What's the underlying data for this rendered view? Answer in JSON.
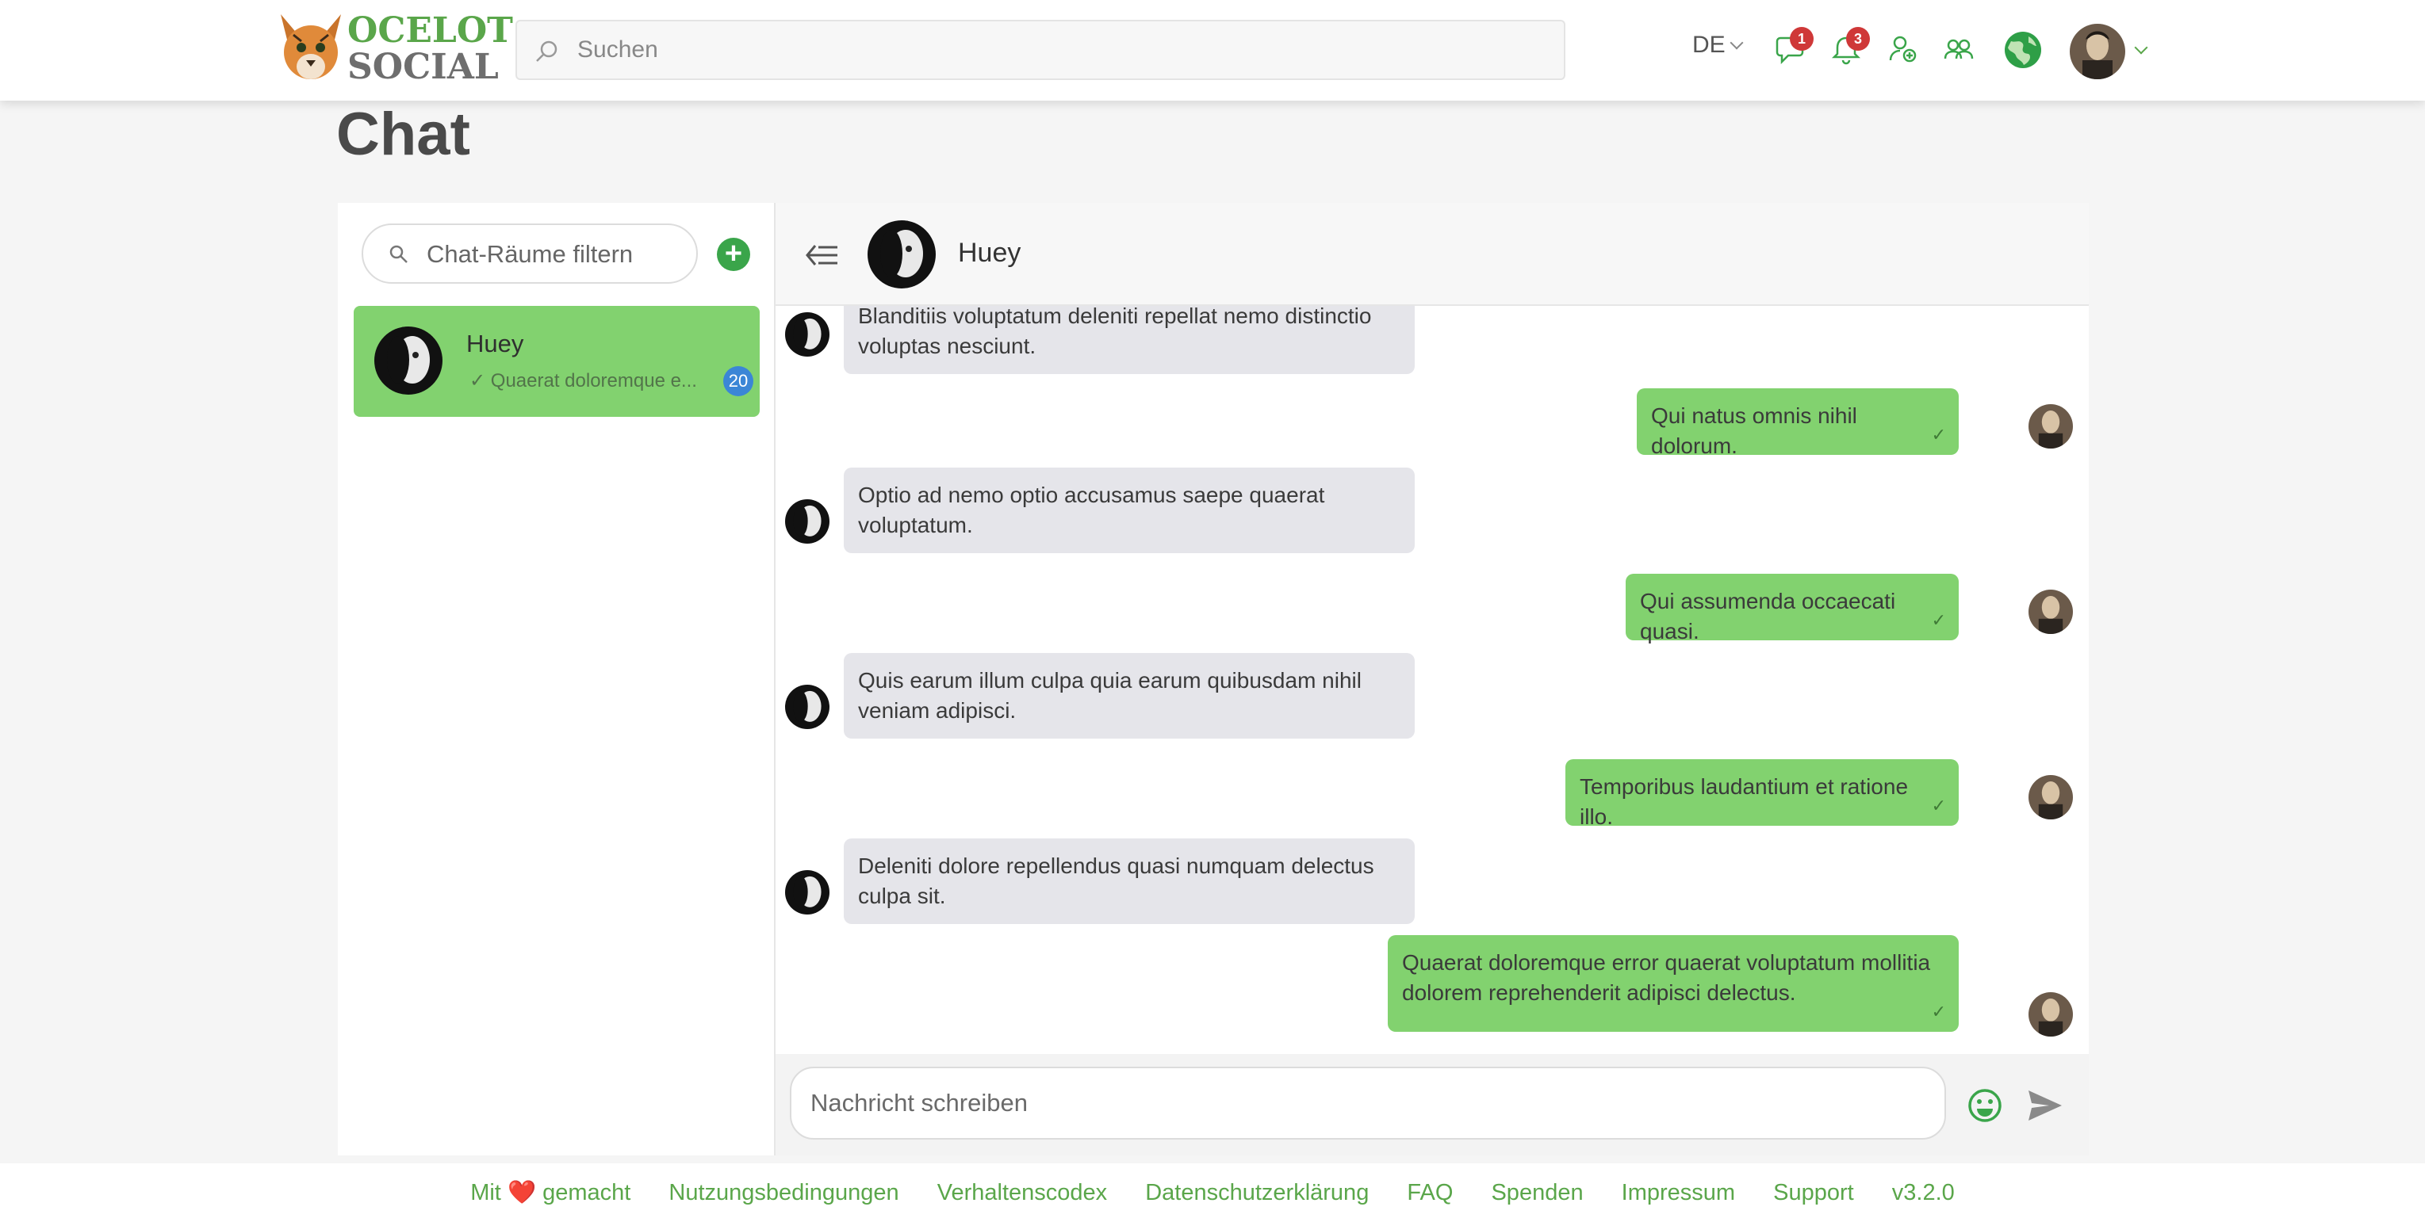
{
  "header": {
    "logo_line1": "OCELOT",
    "logo_line2": "SOCIAL",
    "search_placeholder": "Suchen",
    "language": "DE",
    "chat_badge": "1",
    "notifications_badge": "3"
  },
  "page": {
    "title": "Chat"
  },
  "rooms": {
    "filter_placeholder": "Chat-Räume filtern",
    "add_label": "+",
    "items": [
      {
        "name": "Huey",
        "last_message": "Quaerat doloremque e...",
        "unread": "20",
        "read_mark": "✓"
      }
    ]
  },
  "conversation": {
    "partner": "Huey",
    "messages": [
      {
        "dir": "in",
        "text": "Blanditiis voluptatum deleniti repellat nemo distinctio voluptas nesciunt."
      },
      {
        "dir": "out",
        "text": "Qui natus omnis nihil dolorum.",
        "tick": "✓"
      },
      {
        "dir": "in",
        "text": "Optio ad nemo optio accusamus saepe quaerat voluptatum."
      },
      {
        "dir": "out",
        "text": "Qui assumenda occaecati quasi.",
        "tick": "✓"
      },
      {
        "dir": "in",
        "text": "Quis earum illum culpa quia earum quibusdam nihil veniam adipisci."
      },
      {
        "dir": "out",
        "text": "Temporibus laudantium et ratione illo.",
        "tick": "✓"
      },
      {
        "dir": "in",
        "text": "Deleniti dolore repellendus quasi numquam delectus culpa sit."
      },
      {
        "dir": "out",
        "text": "Quaerat doloremque error quaerat voluptatum mollitia dolorem reprehenderit adipisci delectus.",
        "tick": "✓"
      }
    ],
    "composer_placeholder": "Nachricht schreiben"
  },
  "footer": {
    "made_with_prefix": "Mit",
    "heart": "❤️",
    "made_with_suffix": "gemacht",
    "links": [
      "Nutzungsbedingungen",
      "Verhaltenscodex",
      "Datenschutzerklärung",
      "FAQ",
      "Spenden",
      "Impressum",
      "Support",
      "v3.2.0"
    ]
  },
  "colors": {
    "brand_green": "#5aa64a",
    "outgoing_bubble": "#82d26f",
    "incoming_bubble": "#e5e5ea",
    "badge_red": "#cf3838",
    "unread_blue": "#3b86d6"
  },
  "icons": [
    "ocelot-logo-icon",
    "search-icon",
    "chat-icon",
    "bell-icon",
    "invite-user-icon",
    "groups-icon",
    "globe-icon",
    "avatar",
    "back-icon",
    "emoji-icon",
    "send-icon",
    "add-room-icon"
  ]
}
